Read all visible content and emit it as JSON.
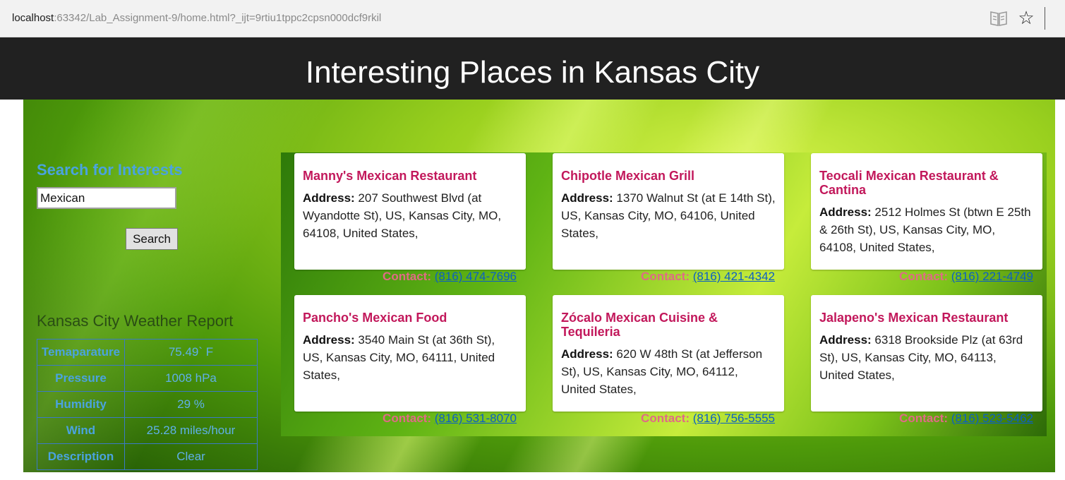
{
  "browser": {
    "url_host": "localhost",
    "url_rest": ":63342/Lab_Assignment-9/home.html?_ijt=9rtiu1tppc2cpsn000dcf9rkil",
    "icons": [
      "reading-view-icon",
      "favorite-star-icon"
    ]
  },
  "header": {
    "title": "Interesting Places in Kansas City"
  },
  "search": {
    "title": "Search for Interests",
    "value": "Mexican",
    "button_label": "Search"
  },
  "weather": {
    "title": "Kansas City Weather Report",
    "rows": [
      {
        "label": "Temaparature",
        "value": "75.49` F"
      },
      {
        "label": "Pressure",
        "value": "1008 hPa"
      },
      {
        "label": "Humidity",
        "value": "29 %"
      },
      {
        "label": "Wind",
        "value": "25.28 miles/hour"
      },
      {
        "label": "Description",
        "value": "Clear"
      }
    ]
  },
  "results": {
    "address_label": "Address:",
    "contact_label": "Contact:",
    "places": [
      {
        "name": "Manny's Mexican Restaurant",
        "address": "207 Southwest Blvd (at Wyandotte St), US, Kansas City, MO, 64108, United States,",
        "phone": "(816) 474-7696"
      },
      {
        "name": "Chipotle Mexican Grill",
        "address": "1370 Walnut St (at E 14th St), US, Kansas City, MO, 64106, United States,",
        "phone": "(816) 421-4342"
      },
      {
        "name": "Teocali Mexican Restaurant & Cantina",
        "address": "2512 Holmes St (btwn E 25th & 26th St), US, Kansas City, MO, 64108, United States,",
        "phone": "(816) 221-4749"
      },
      {
        "name": "Pancho's Mexican Food",
        "address": "3540 Main St (at 36th St), US, Kansas City, MO, 64111, United States,",
        "phone": "(816) 531-8070"
      },
      {
        "name": "Zócalo Mexican Cuisine & Tequileria",
        "address": "620 W 48th St (at Jefferson St), US, Kansas City, MO, 64112, United States,",
        "phone": "(816) 756-5555"
      },
      {
        "name": "Jalapeno's Mexican Restaurant",
        "address": "6318 Brookside Plz (at 63rd St), US, Kansas City, MO, 64113, United States,",
        "phone": "(816) 523-5462"
      }
    ]
  }
}
